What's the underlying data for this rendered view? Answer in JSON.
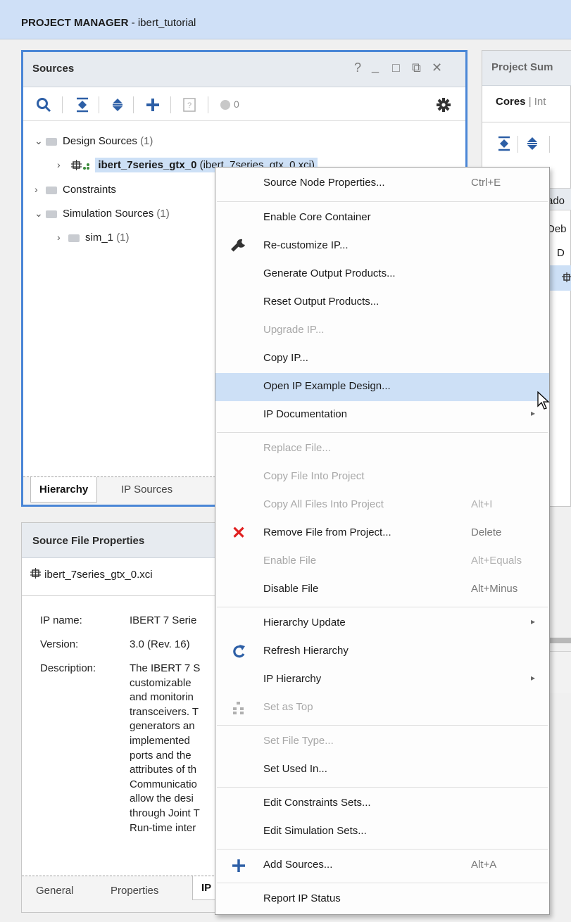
{
  "header": {
    "title_bold": "PROJECT MANAGER",
    "title_rest": " - ibert_tutorial"
  },
  "sources_panel": {
    "title": "Sources",
    "window_buttons": [
      "?",
      "_",
      "□",
      "⧉",
      "✕"
    ],
    "toolbar": {
      "badge_count": "0"
    },
    "tree": [
      {
        "label": "Design Sources",
        "count": "(1)",
        "expanded": true
      },
      {
        "label": "ibert_7series_gtx_0",
        "suffix": "(ibert_7series_gtx_0.xci)"
      },
      {
        "label": "Constraints"
      },
      {
        "label": "Simulation Sources",
        "count": "(1)",
        "expanded": true
      },
      {
        "label": "sim_1",
        "count": "(1)"
      }
    ],
    "tabs": [
      "Hierarchy",
      "IP Sources"
    ]
  },
  "summary_panel": {
    "title": "Project Sum",
    "tabs_text": "Cores",
    "tabs_rest": "| Int",
    "rows": [
      "ado",
      "Deb",
      "D"
    ]
  },
  "props_panel": {
    "title": "Source File Properties",
    "file": "ibert_7series_gtx_0.xci",
    "ip_name_label": "IP name:",
    "ip_name_value": "IBERT 7 Serie",
    "version_label": "Version:",
    "version_value": "3.0 (Rev. 16)",
    "description_label": "Description:",
    "description_lines": [
      "The IBERT 7 S",
      "customizable",
      "and monitorin",
      "transceivers. T",
      "generators an",
      "implemented",
      "ports and the",
      "attributes of th",
      "Communicatio",
      "allow the desi",
      "through Joint T",
      "Run-time inter"
    ],
    "tabs": [
      "General",
      "Properties",
      "IP"
    ]
  },
  "context_menu": {
    "items": [
      {
        "label": "Source Node Properties...",
        "shortcut": "Ctrl+E"
      },
      {
        "label": "Enable Core Container"
      },
      {
        "label": "Re-customize IP...",
        "icon": "wrench-icon"
      },
      {
        "label": "Generate Output Products..."
      },
      {
        "label": "Reset Output Products..."
      },
      {
        "label": "Upgrade IP...",
        "disabled": true
      },
      {
        "label": "Copy IP..."
      },
      {
        "label": "Open IP Example Design...",
        "highlighted": true
      },
      {
        "label": "IP Documentation",
        "submenu": true
      },
      {
        "label": "Replace File...",
        "disabled": true
      },
      {
        "label": "Copy File Into Project",
        "disabled": true
      },
      {
        "label": "Copy All Files Into Project",
        "shortcut": "Alt+I",
        "disabled": true
      },
      {
        "label": "Remove File from Project...",
        "shortcut": "Delete",
        "icon": "delete-x-icon"
      },
      {
        "label": "Enable File",
        "shortcut": "Alt+Equals",
        "disabled": true
      },
      {
        "label": "Disable File",
        "shortcut": "Alt+Minus"
      },
      {
        "label": "Hierarchy Update",
        "submenu": true
      },
      {
        "label": "Refresh Hierarchy",
        "icon": "refresh-icon"
      },
      {
        "label": "IP Hierarchy",
        "submenu": true
      },
      {
        "label": "Set as Top",
        "disabled": true,
        "icon": "set-top-icon"
      },
      {
        "label": "Set File Type...",
        "disabled": true
      },
      {
        "label": "Set Used In..."
      },
      {
        "label": "Edit Constraints Sets..."
      },
      {
        "label": "Edit Simulation Sets..."
      },
      {
        "label": "Add Sources...",
        "shortcut": "Alt+A",
        "icon": "plus-icon"
      },
      {
        "label": "Report IP Status"
      }
    ]
  },
  "colors": {
    "accent": "#4a86d6",
    "highlight": "#cde0f6",
    "delete_red": "#e02020",
    "header_bg": "#cfe0f7"
  }
}
